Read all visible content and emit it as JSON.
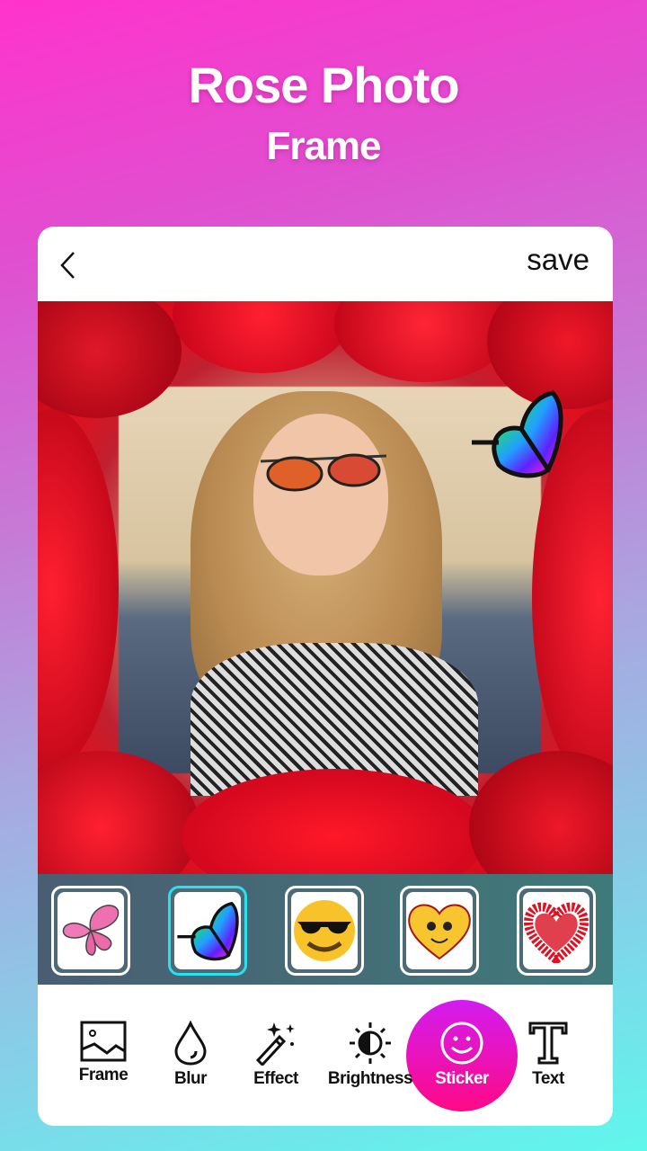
{
  "headline": {
    "line1": "Rose Photo",
    "line2": "Frame"
  },
  "topbar": {
    "back_icon": "chevron-left-icon",
    "save_label": "save"
  },
  "photo": {
    "description": "Woman with sunglasses in rose petal frame",
    "sticker_applied": "rainbow-butterfly"
  },
  "stickers": [
    {
      "name": "pink-butterfly",
      "selected": false
    },
    {
      "name": "rainbow-butterfly",
      "selected": true
    },
    {
      "name": "sunglasses-emoji",
      "selected": false
    },
    {
      "name": "heart-smiley",
      "selected": false
    },
    {
      "name": "red-heart-petals",
      "selected": false
    }
  ],
  "tools": [
    {
      "label": "Frame",
      "icon": "image-icon"
    },
    {
      "label": "Blur",
      "icon": "drop-icon"
    },
    {
      "label": "Effect",
      "icon": "magic-wand-icon"
    },
    {
      "label": "Brightness",
      "icon": "brightness-icon"
    },
    {
      "label": "Sticker",
      "icon": "smiley-icon",
      "active": true
    },
    {
      "label": "Text",
      "icon": "text-icon"
    }
  ],
  "colors": {
    "accent_gradient_start": "#d21cf0",
    "accent_gradient_end": "#ff0a86",
    "selected_border": "#29e0ee",
    "strip_bg": "#456c76"
  }
}
